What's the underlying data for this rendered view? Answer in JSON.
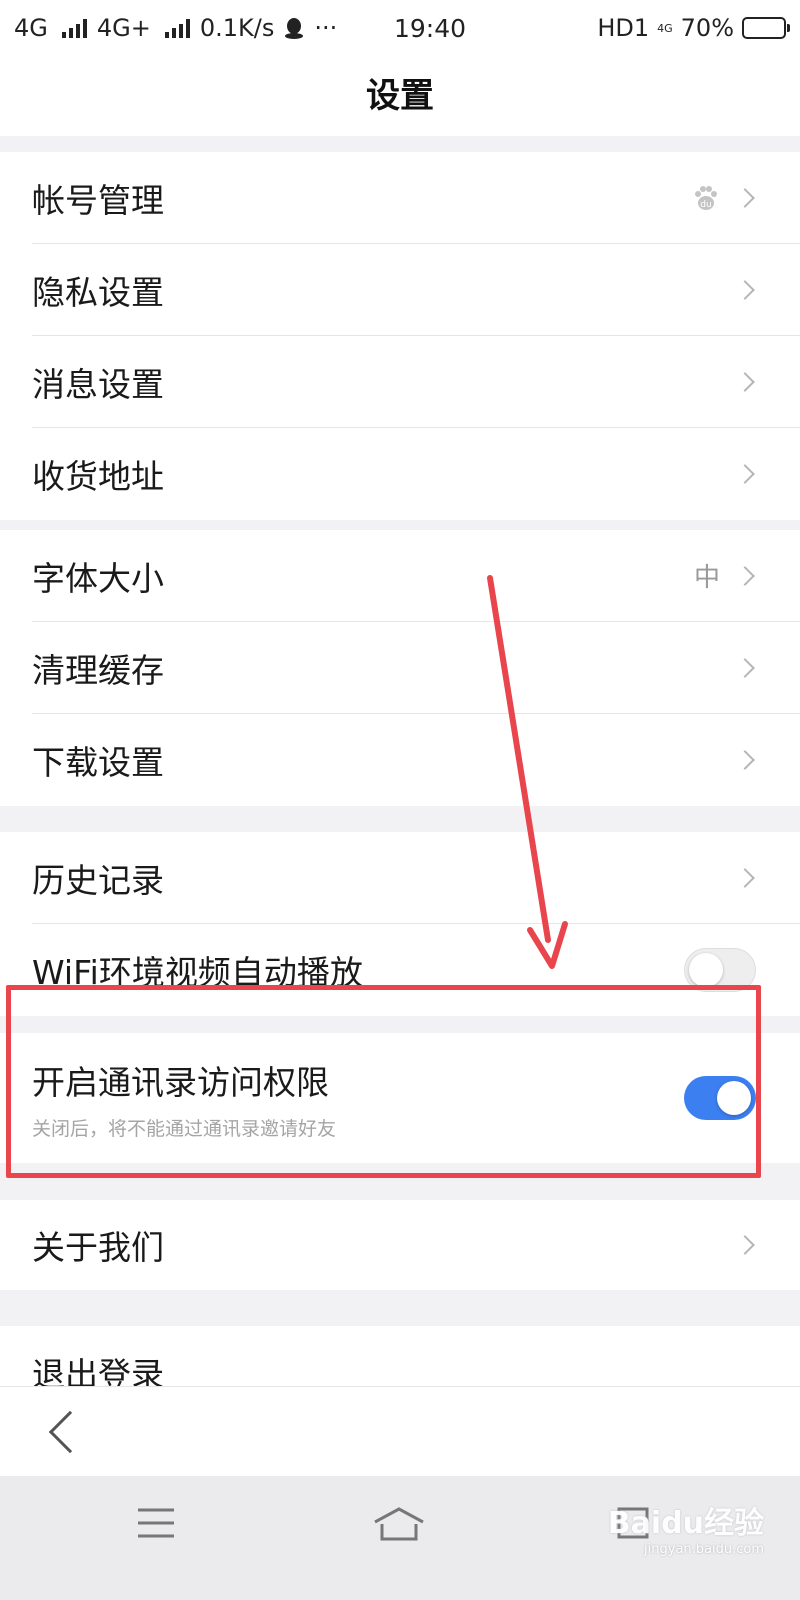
{
  "status_bar": {
    "network_1": "4G",
    "network_2": "4G+",
    "speed": "0.1K/s",
    "more": "···",
    "time": "19:40",
    "hd": "HD1",
    "network_3": "4G",
    "battery": "70%",
    "battery_level": 0.7
  },
  "header": {
    "title": "设置"
  },
  "groups": [
    {
      "items": [
        {
          "label": "帐号管理",
          "icon": "baidu-paw-icon"
        },
        {
          "label": "隐私设置"
        },
        {
          "label": "消息设置"
        },
        {
          "label": "收货地址"
        }
      ]
    },
    {
      "items": [
        {
          "label": "字体大小",
          "value": "中"
        },
        {
          "label": "清理缓存"
        },
        {
          "label": "下载设置"
        }
      ]
    },
    {
      "items": [
        {
          "label": "历史记录"
        },
        {
          "label": "WiFi环境视频自动播放",
          "toggle": false
        }
      ]
    },
    {
      "items": [
        {
          "label": "开启通讯录访问权限",
          "subtitle": "关闭后，将不能通过通讯录邀请好友",
          "toggle": true
        }
      ]
    },
    {
      "items": [
        {
          "label": "关于我们"
        }
      ]
    },
    {
      "items": [
        {
          "label": "退出登录"
        }
      ]
    }
  ],
  "annotation": {
    "color": "#e8454c"
  },
  "toggle_on_color": "#3b7ff0",
  "watermark": {
    "text": "Baidu经验",
    "sub": "jingyan.baidu.com"
  }
}
